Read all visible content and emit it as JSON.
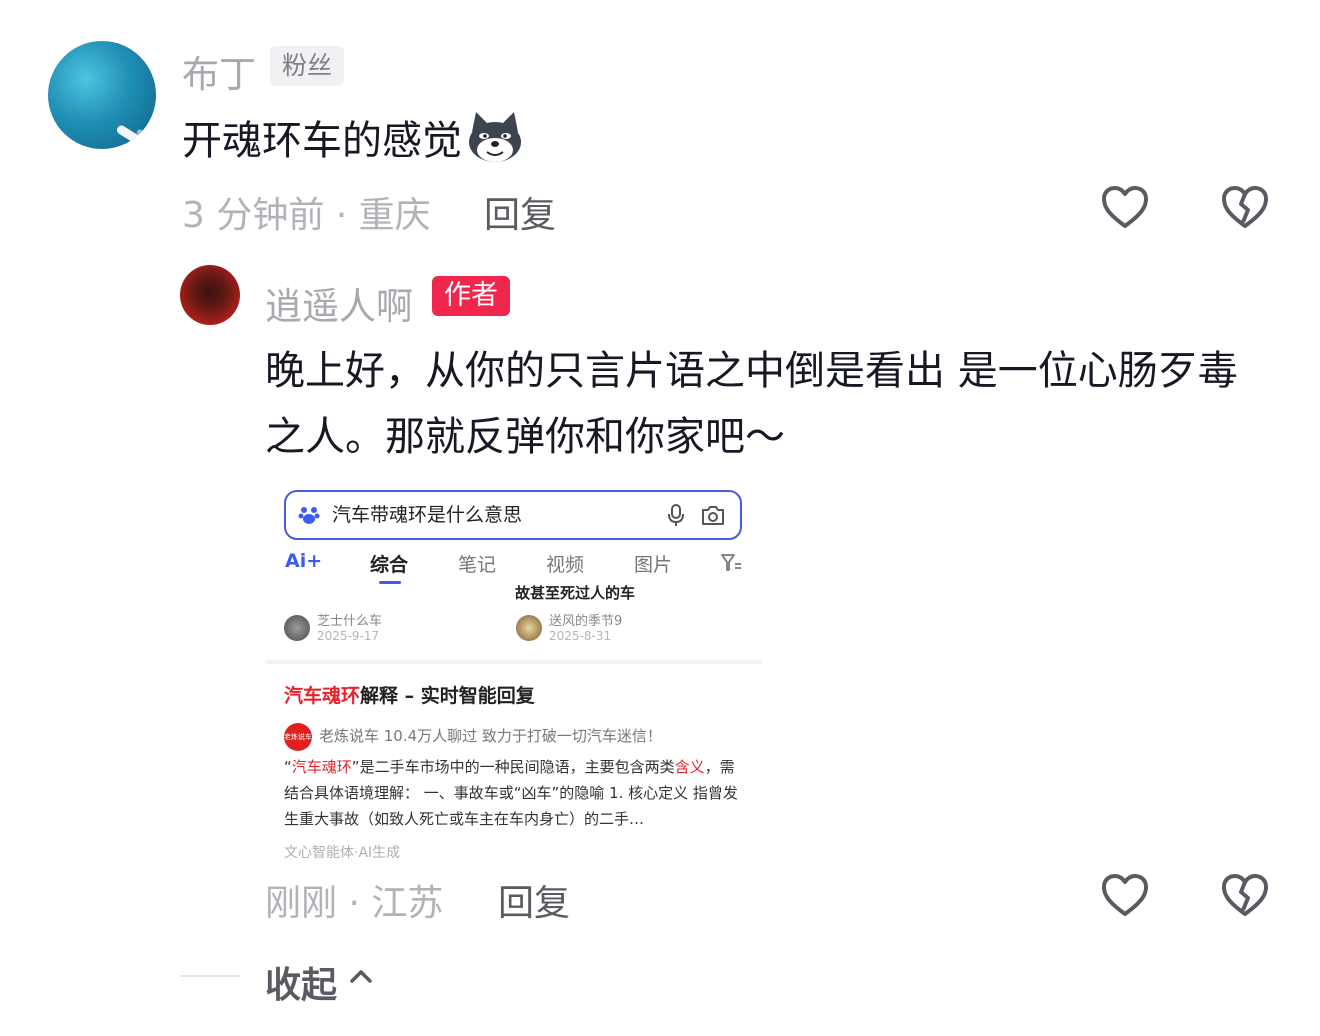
{
  "comment": {
    "username": "布丁",
    "badge": "粉丝",
    "text": "开魂环车的感觉",
    "emoji": "wolf-grin-emoji",
    "meta": "3 分钟前 · 重庆",
    "reply_label": "回复",
    "icons": {
      "like": "heart-outline-icon",
      "dislike": "broken-heart-icon"
    }
  },
  "reply": {
    "username": "逍遥人啊",
    "badge": "作者",
    "text": "晚上好，从你的只言片语之中倒是看出 是一位心肠歹毒之人。那就反弹你和你家吧～",
    "meta": "刚刚 · 江苏",
    "reply_label": "回复",
    "badge_color": "#f0264c"
  },
  "embedded_screenshot": {
    "search_query": "汽车带魂环是什么意思",
    "tabs": [
      "Ai+",
      "综合",
      "笔记",
      "视频",
      "图片"
    ],
    "active_tab": "综合",
    "cut_title": "故甚至死过人的车",
    "card_a": {
      "author": "芝士什么车",
      "date": "2025-9-17"
    },
    "card_b": {
      "author": "送风的季节9",
      "date": "2025-8-31"
    },
    "result_title_highlight": "汽车魂环",
    "result_title_rest": "解释 – 实时智能回复",
    "source_logo_text": "老炼说车",
    "source_line": "老炼说车   10.4万人聊过   致力于打破一切汽车迷信！",
    "body_1": "“",
    "body_2": "汽车魂环",
    "body_3": "”是二手车市场中的一种民间隐语，主要包含两类",
    "body_4": "含义",
    "body_5": "，需结合具体语境理解： 一、事故车或“凶车”的隐喻 1. 核心定义 指曾发生重大事故（如致人死亡或车主在车内身亡）的二手…",
    "ai_source": "文心智能体·AI生成",
    "accent": "#3b5cf0",
    "highlight": "#e8232c"
  },
  "collapse_label": "收起"
}
